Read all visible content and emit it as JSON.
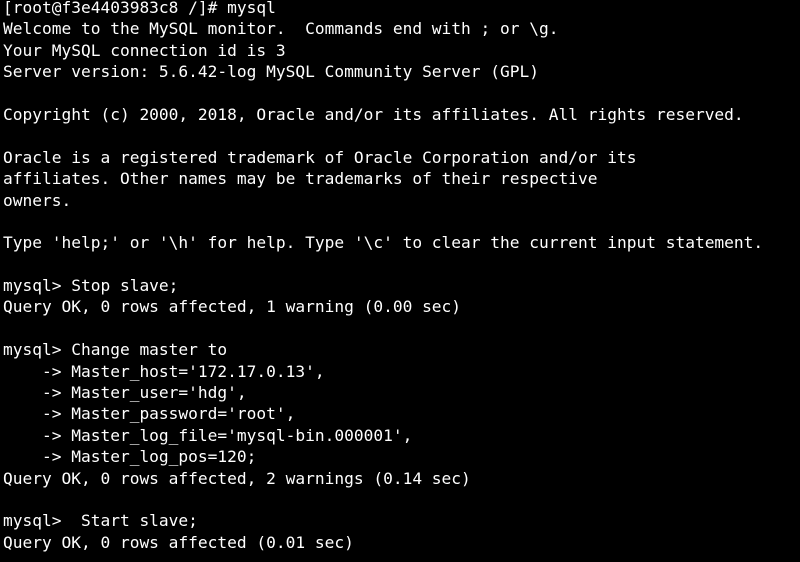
{
  "terminal": {
    "background": "#000000",
    "foreground": "#ffffff",
    "lines": [
      "[root@f3e4403983c8 /]# mysql",
      "Welcome to the MySQL monitor.  Commands end with ; or \\g.",
      "Your MySQL connection id is 3",
      "Server version: 5.6.42-log MySQL Community Server (GPL)",
      "",
      "Copyright (c) 2000, 2018, Oracle and/or its affiliates. All rights reserved.",
      "",
      "Oracle is a registered trademark of Oracle Corporation and/or its",
      "affiliates. Other names may be trademarks of their respective",
      "owners.",
      "",
      "Type 'help;' or '\\h' for help. Type '\\c' to clear the current input statement.",
      "",
      "mysql> Stop slave;",
      "Query OK, 0 rows affected, 1 warning (0.00 sec)",
      "",
      "mysql> Change master to",
      "    -> Master_host='172.17.0.13',",
      "    -> Master_user='hdg',",
      "    -> Master_password='root',",
      "    -> Master_log_file='mysql-bin.000001',",
      "    -> Master_log_pos=120;",
      "Query OK, 0 rows affected, 2 warnings (0.14 sec)",
      "",
      "mysql>  Start slave;",
      "Query OK, 0 rows affected (0.01 sec)"
    ]
  }
}
